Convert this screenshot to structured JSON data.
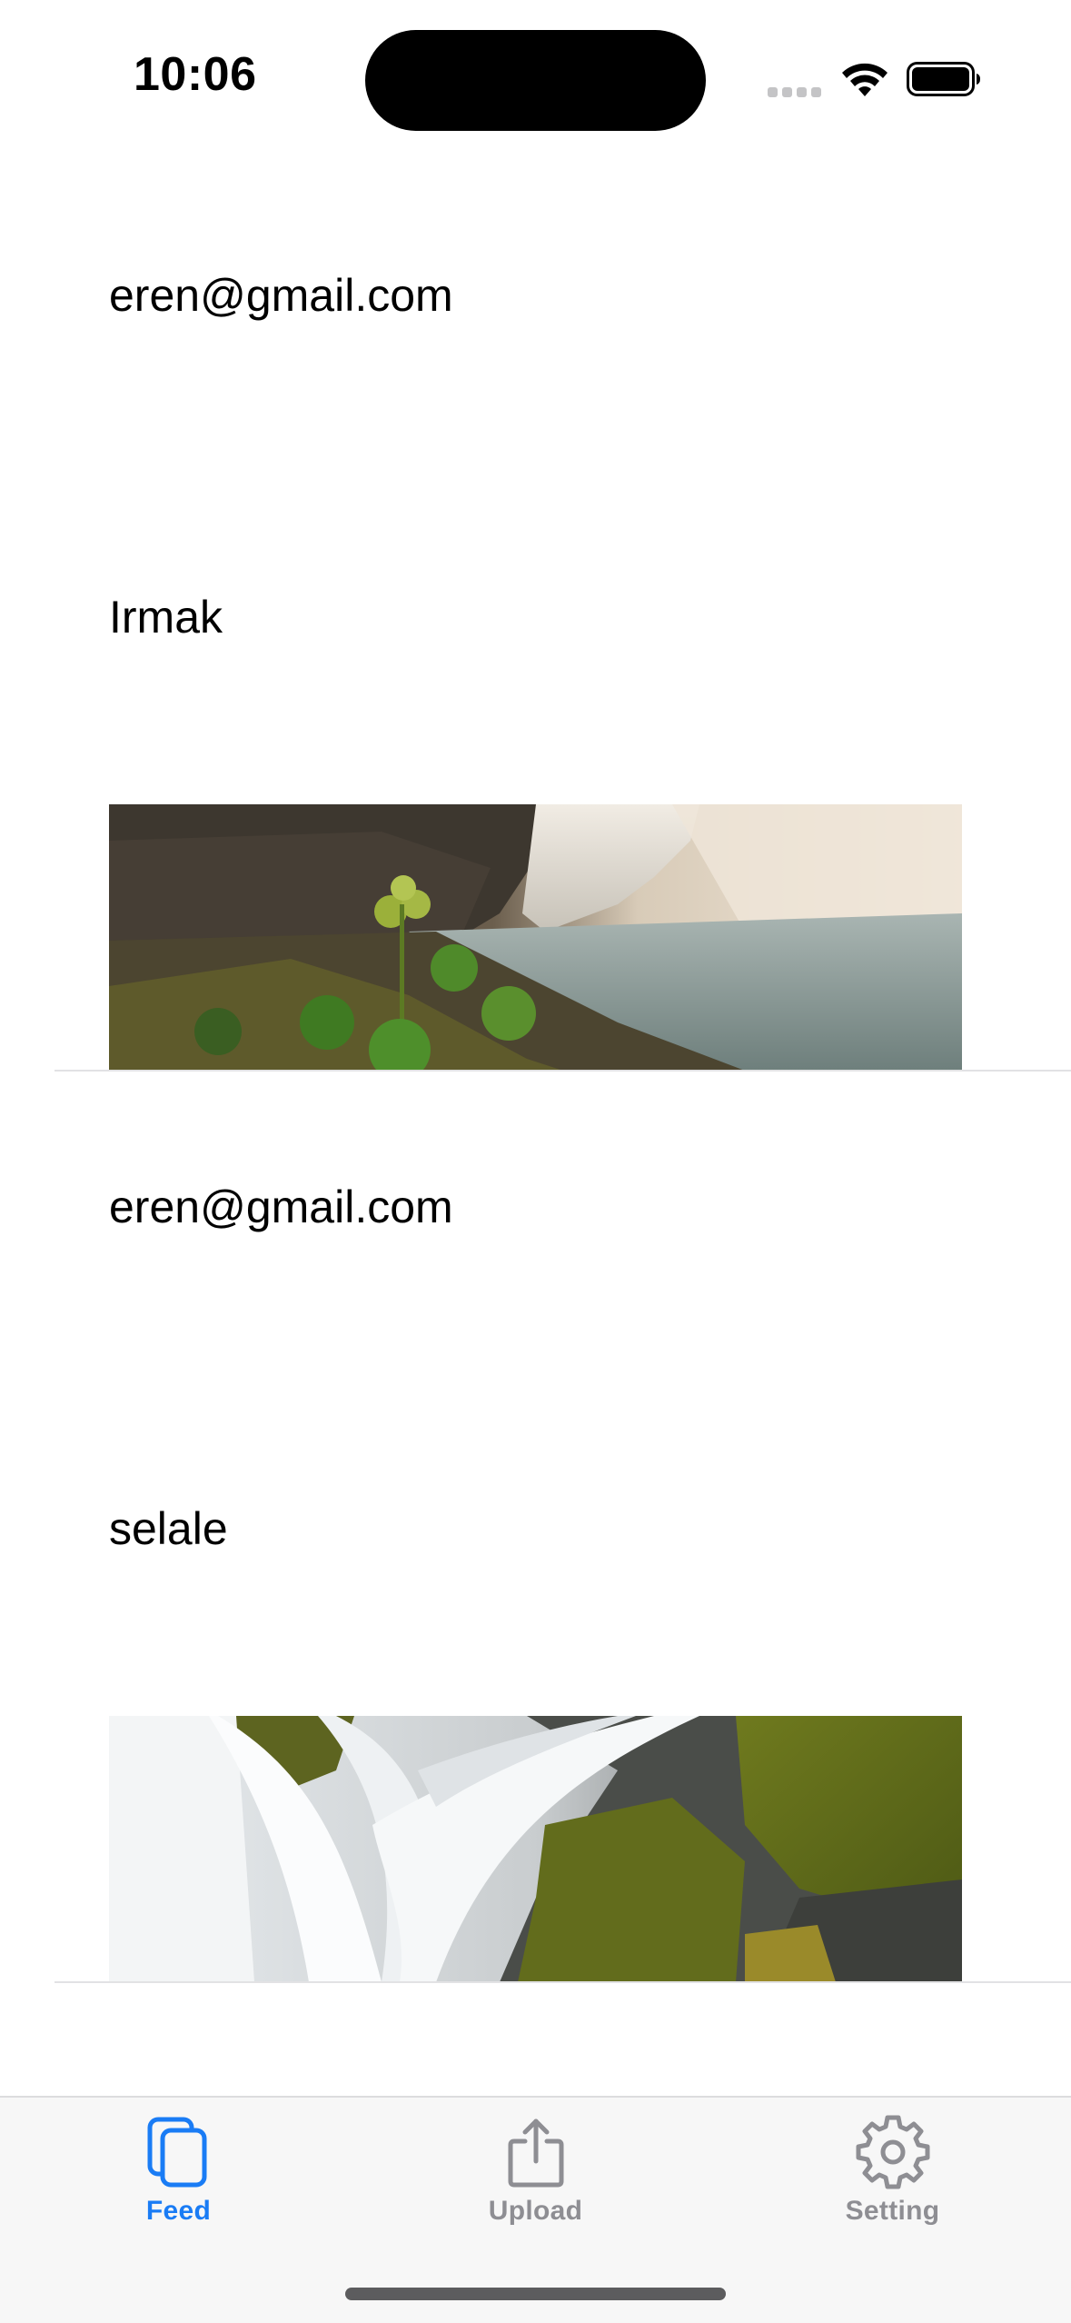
{
  "status_bar": {
    "time": "10:06"
  },
  "feed": {
    "posts": [
      {
        "email": "eren@gmail.com",
        "comment": "Irmak",
        "image": "waterfall-river-photo"
      },
      {
        "email": "eren@gmail.com",
        "comment": "selale",
        "image": "waterfall-moss-photo"
      }
    ]
  },
  "tab_bar": {
    "tabs": [
      {
        "label": "Feed",
        "icon": "feed-icon",
        "active": true
      },
      {
        "label": "Upload",
        "icon": "upload-icon",
        "active": false
      },
      {
        "label": "Setting",
        "icon": "gear-icon",
        "active": false
      }
    ],
    "active_color": "#1a7cf5",
    "inactive_color": "#8e8e93"
  }
}
